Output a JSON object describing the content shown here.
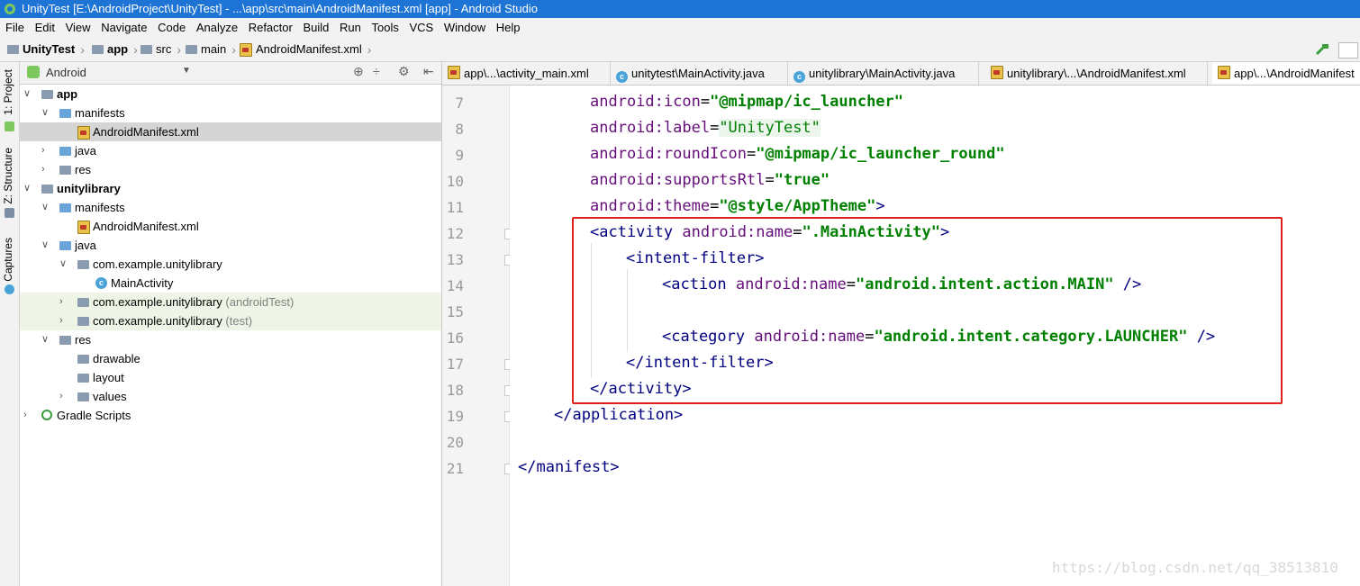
{
  "window": {
    "title": "UnityTest [E:\\AndroidProject\\UnityTest] - ...\\app\\src\\main\\AndroidManifest.xml [app] - Android Studio"
  },
  "menu": [
    "File",
    "Edit",
    "View",
    "Navigate",
    "Code",
    "Analyze",
    "Refactor",
    "Build",
    "Run",
    "Tools",
    "VCS",
    "Window",
    "Help"
  ],
  "breadcrumb": [
    "UnityTest",
    "app",
    "src",
    "main",
    "AndroidManifest.xml"
  ],
  "project_panel": {
    "view_selector": "Android",
    "tree": [
      {
        "label": "app",
        "bold": true,
        "level": 0
      },
      {
        "label": "manifests",
        "level": 1
      },
      {
        "label": "AndroidManifest.xml",
        "level": 2,
        "selected": true
      },
      {
        "label": "java",
        "level": 1
      },
      {
        "label": "res",
        "level": 1
      },
      {
        "label": "unitylibrary",
        "bold": true,
        "level": 0
      },
      {
        "label": "manifests",
        "level": 1
      },
      {
        "label": "AndroidManifest.xml",
        "level": 2
      },
      {
        "label": "java",
        "level": 1
      },
      {
        "label": "com.example.unitylibrary",
        "level": 2
      },
      {
        "label": "MainActivity",
        "level": 3
      },
      {
        "label": "com.example.unitylibrary",
        "suffix": "(androidTest)",
        "level": 2
      },
      {
        "label": "com.example.unitylibrary",
        "suffix": "(test)",
        "level": 2
      },
      {
        "label": "res",
        "level": 1
      },
      {
        "label": "drawable",
        "level": 2
      },
      {
        "label": "layout",
        "level": 2
      },
      {
        "label": "values",
        "level": 2
      },
      {
        "label": "Gradle Scripts",
        "level": 0
      }
    ]
  },
  "side_tabs": [
    "1: Project",
    "Z: Structure",
    "Captures"
  ],
  "editor_tabs": [
    "app\\...\\activity_main.xml",
    "unitytest\\MainActivity.java",
    "unitylibrary\\MainActivity.java",
    "unitylibrary\\...\\AndroidManifest.xml",
    "app\\...\\AndroidManifest"
  ],
  "code": {
    "line_numbers": [
      "7",
      "8",
      "9",
      "10",
      "11",
      "12",
      "13",
      "14",
      "15",
      "16",
      "17",
      "18",
      "19",
      "20",
      "21"
    ],
    "l7": {
      "attr": "android:icon",
      "val": "\"@mipmap/ic_launcher\""
    },
    "l8": {
      "attr": "android:label",
      "val": "\"UnityTest\""
    },
    "l9": {
      "attr": "android:roundIcon",
      "val": "\"@mipmap/ic_launcher_round\""
    },
    "l10": {
      "attr": "android:supportsRtl",
      "val": "\"true\""
    },
    "l11": {
      "attr": "android:theme",
      "val": "\"@style/AppTheme\"",
      "end": ">"
    },
    "l12": {
      "open": "<activity",
      "attr": "android:name",
      "val": "\".MainActivity\"",
      "end": ">"
    },
    "l13": {
      "text": "<intent-filter>"
    },
    "l14": {
      "open": "<action",
      "attr": "android:name",
      "val": "\"android.intent.action.MAIN\"",
      "end": " />"
    },
    "l16": {
      "open": "<category",
      "attr": "android:name",
      "val": "\"android.intent.category.LAUNCHER\"",
      "end": " />"
    },
    "l17": {
      "text": "</intent-filter>"
    },
    "l18": {
      "text": "</activity>"
    },
    "l19": {
      "text": "</application>"
    },
    "l21": {
      "text": "</manifest>"
    }
  },
  "watermark": "https://blog.csdn.net/qq_38513810",
  "colors": {
    "title_bar": "#1e74d4",
    "highlight_box": "#e0201b"
  }
}
